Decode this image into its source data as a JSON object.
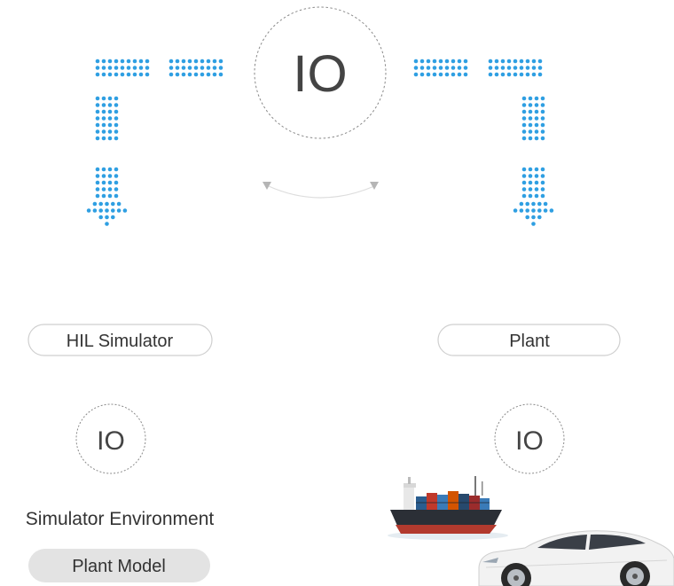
{
  "io_labels": {
    "top": "IO",
    "left": "IO",
    "right": "IO"
  },
  "hil_simulator": {
    "label": "HIL Simulator"
  },
  "plant": {
    "label": "Plant"
  },
  "simulator_environment": {
    "label": "Simulator Environment"
  },
  "plant_model": {
    "label": "Plant Model"
  },
  "colors": {
    "dots": "#2f9fe2",
    "circle_border": "#8a8a8a",
    "pill_border": "#cfcfcf",
    "plant_model_fill": "#e3e3e3",
    "exchange_arc": "#dddddd",
    "exchange_arrow": "#b5b5b5"
  },
  "icons": [
    "ship-image",
    "car-image",
    "down-arrow-icon"
  ]
}
